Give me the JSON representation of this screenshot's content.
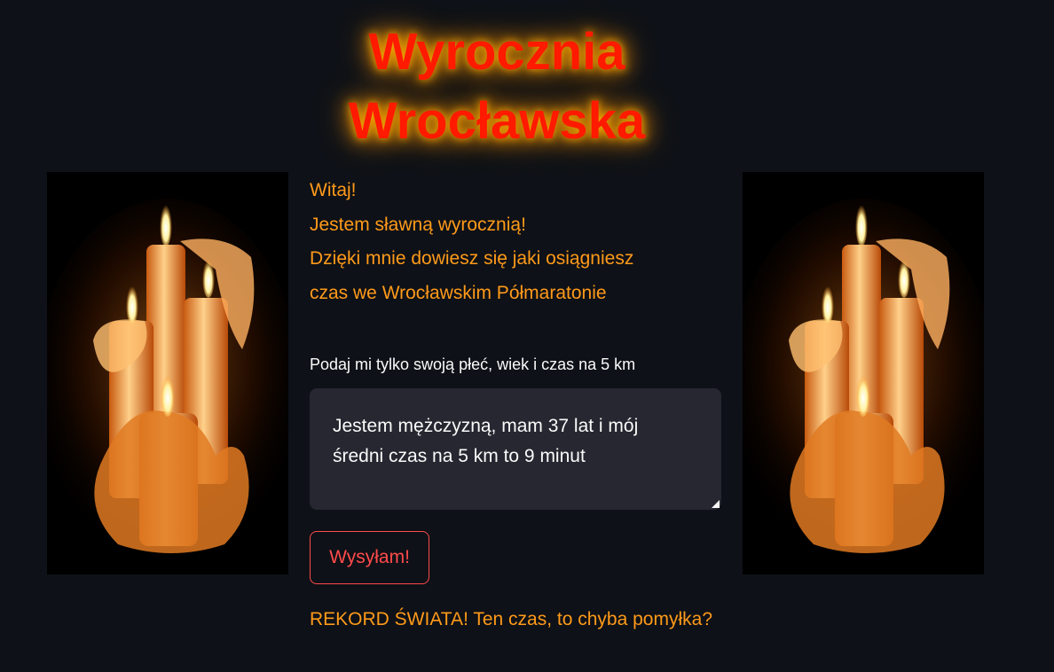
{
  "header": {
    "title_line1": "Wyrocznia",
    "title_line2": "Wrocławska"
  },
  "intro": {
    "line1": "Witaj!",
    "line2": "Jestem sławną wyrocznią!",
    "line3": "Dzięki mnie dowiesz się jaki osiągniesz",
    "line4": "czas we Wrocławskim Półmaratonie"
  },
  "form": {
    "label": "Podaj mi tylko swoją płeć, wiek i czas na 5 km",
    "textarea_line1": "Jestem mężczyzną, mam 37 lat i mój",
    "textarea_line2": "średni czas na 5 km to 9 minut",
    "submit_label": "Wysyłam!"
  },
  "result": {
    "text": "REKORD ŚWIATA! Ten czas, to chyba pomyłka?"
  },
  "images": {
    "left": "candles-image",
    "right": "candles-image"
  },
  "colors": {
    "background": "#0e1117",
    "title": "#ff1a00",
    "title_glow": "#ffae00",
    "accent_text": "#ff9a1a",
    "button": "#ff4b4b",
    "input_bg": "#262730"
  }
}
